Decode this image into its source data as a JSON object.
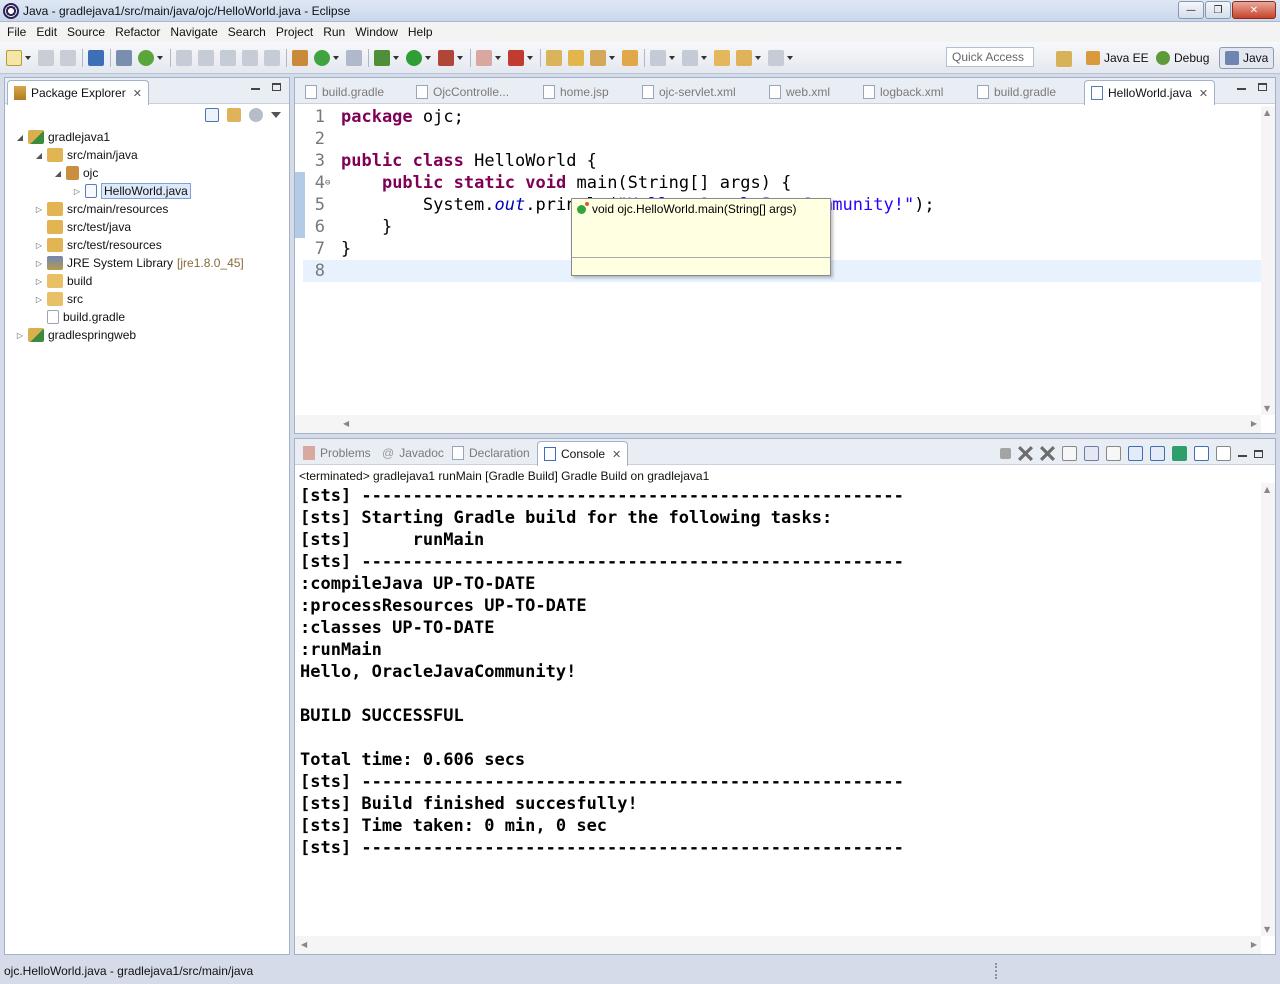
{
  "window": {
    "title": "Java - gradlejava1/src/main/java/ojc/HelloWorld.java - Eclipse",
    "minimize": "—",
    "maximize": "❐",
    "close": "✕"
  },
  "menu": [
    "File",
    "Edit",
    "Source",
    "Refactor",
    "Navigate",
    "Search",
    "Project",
    "Run",
    "Window",
    "Help"
  ],
  "toolbar": {
    "quick_access": "Quick Access",
    "perspectives": [
      "Java EE",
      "Debug",
      "Java"
    ]
  },
  "package_explorer": {
    "tab_label": "Package Explorer",
    "tree": [
      {
        "label": "gradlejava1",
        "depth": 0,
        "twisty": "expanded",
        "icon": "gradle-project-icon"
      },
      {
        "label": "src/main/java",
        "depth": 1,
        "twisty": "expanded",
        "icon": "source-folder-icon"
      },
      {
        "label": "ojc",
        "depth": 2,
        "twisty": "expanded",
        "icon": "package-icon"
      },
      {
        "label": "HelloWorld.java",
        "depth": 3,
        "twisty": "collapsed",
        "icon": "java-file-icon",
        "selected": true
      },
      {
        "label": "src/main/resources",
        "depth": 1,
        "twisty": "collapsed",
        "icon": "source-folder-icon"
      },
      {
        "label": "src/test/java",
        "depth": 1,
        "twisty": "none",
        "icon": "source-folder-icon"
      },
      {
        "label": "src/test/resources",
        "depth": 1,
        "twisty": "collapsed",
        "icon": "source-folder-icon"
      },
      {
        "label": "JRE System Library",
        "deco": "[jre1.8.0_45]",
        "depth": 1,
        "twisty": "collapsed",
        "icon": "library-icon"
      },
      {
        "label": "build",
        "depth": 1,
        "twisty": "collapsed",
        "icon": "folder-icon"
      },
      {
        "label": "src",
        "depth": 1,
        "twisty": "collapsed",
        "icon": "folder-icon"
      },
      {
        "label": "build.gradle",
        "depth": 1,
        "twisty": "none",
        "icon": "file-icon"
      },
      {
        "label": "gradlespringweb",
        "depth": 0,
        "twisty": "collapsed",
        "icon": "gradle-project-icon"
      }
    ]
  },
  "editor": {
    "tabs": [
      {
        "label": "build.gradle",
        "active": false
      },
      {
        "label": "OjcControlle...",
        "active": false
      },
      {
        "label": "home.jsp",
        "active": false
      },
      {
        "label": "ojc-servlet.xml",
        "active": false
      },
      {
        "label": "web.xml",
        "active": false
      },
      {
        "label": "logback.xml",
        "active": false
      },
      {
        "label": "build.gradle",
        "active": false
      },
      {
        "label": "HelloWorld.java",
        "active": true
      }
    ],
    "lines": [
      {
        "num": "1",
        "segments": [
          [
            "kw",
            "package"
          ],
          [
            "",
            " ojc;"
          ]
        ]
      },
      {
        "num": "2",
        "segments": []
      },
      {
        "num": "3",
        "segments": [
          [
            "kw",
            "public"
          ],
          [
            "",
            " "
          ],
          [
            "kw",
            "class"
          ],
          [
            "",
            " HelloWorld {"
          ]
        ]
      },
      {
        "num": "4",
        "segments": [
          [
            "",
            "    "
          ],
          [
            "kw",
            "public"
          ],
          [
            "",
            " "
          ],
          [
            "kw",
            "static"
          ],
          [
            "",
            " "
          ],
          [
            "kw",
            "void"
          ],
          [
            "",
            " main(String[] args) {"
          ]
        ]
      },
      {
        "num": "5",
        "segments": [
          [
            "",
            "        System."
          ],
          [
            "fld",
            "out"
          ],
          [
            "",
            ".println("
          ],
          [
            "str",
            "\"Hello, OracleJavaCommunity!\""
          ],
          [
            "",
            ");"
          ]
        ]
      },
      {
        "num": "6",
        "segments": [
          [
            "",
            "    }"
          ]
        ]
      },
      {
        "num": "7",
        "segments": [
          [
            "",
            "}"
          ]
        ]
      },
      {
        "num": "8",
        "segments": []
      }
    ],
    "tooltip": "void ojc.HelloWorld.main(String[] args)"
  },
  "bottom_panel": {
    "tabs": [
      {
        "label": "Problems",
        "active": false
      },
      {
        "label": "Javadoc",
        "active": false
      },
      {
        "label": "Declaration",
        "active": false
      },
      {
        "label": "Console",
        "active": true
      }
    ],
    "console_label": "<terminated> gradlejava1 runMain [Gradle Build] Gradle Build on gradlejava1",
    "console_lines": [
      "[sts] -----------------------------------------------------",
      "[sts] Starting Gradle build for the following tasks:",
      "[sts]      runMain",
      "[sts] -----------------------------------------------------",
      ":compileJava UP-TO-DATE",
      ":processResources UP-TO-DATE",
      ":classes UP-TO-DATE",
      ":runMain",
      "Hello, OracleJavaCommunity!",
      "",
      "BUILD SUCCESSFUL",
      "",
      "Total time: 0.606 secs",
      "[sts] -----------------------------------------------------",
      "[sts] Build finished succesfully!",
      "[sts] Time taken: 0 min, 0 sec",
      "[sts] -----------------------------------------------------"
    ]
  },
  "status": {
    "path": "ojc.HelloWorld.java - gradlejava1/src/main/java"
  }
}
